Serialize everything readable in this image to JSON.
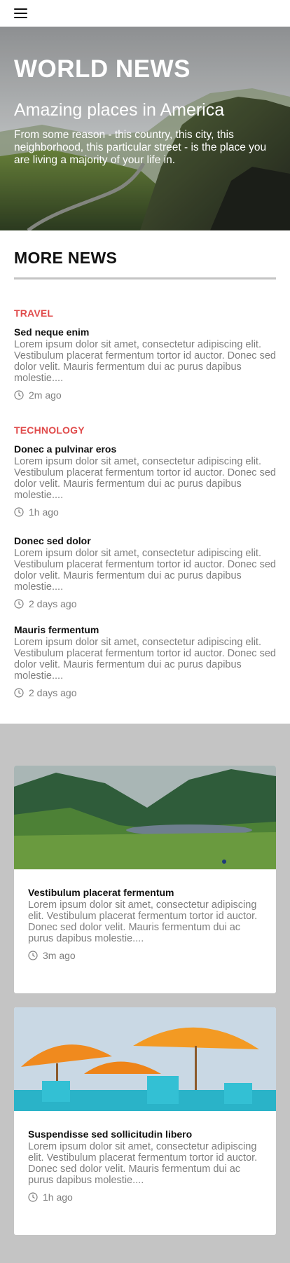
{
  "header": {
    "menu_icon": "hamburger-menu-icon"
  },
  "hero": {
    "title": "WORLD NEWS",
    "subtitle": "Amazing places in America",
    "description": "From some reason - this country, this city, this neighborhood, this particular street - is the place you are living a majority of your life in."
  },
  "more_news": {
    "heading": "MORE NEWS",
    "articles": [
      {
        "category": "TRAVEL",
        "title": "Sed neque enim",
        "body": "Lorem ipsum dolor sit amet, consectetur adipiscing elit. Vestibulum placerat fermentum tortor id auctor. Donec sed dolor velit. Mauris fermentum dui ac purus dapibus molestie....",
        "time": "2m ago"
      },
      {
        "category": "TECHNOLOGY",
        "title": "Donec a pulvinar eros",
        "body": "Lorem ipsum dolor sit amet, consectetur adipiscing elit. Vestibulum placerat fermentum tortor id auctor. Donec sed dolor velit. Mauris fermentum dui ac purus dapibus molestie....",
        "time": "1h ago"
      },
      {
        "title": "Donec sed dolor",
        "body": "Lorem ipsum dolor sit amet, consectetur adipiscing elit. Vestibulum placerat fermentum tortor id auctor. Donec sed dolor velit. Mauris fermentum dui ac purus dapibus molestie....",
        "time": "2 days ago"
      },
      {
        "title": "Mauris fermentum",
        "body": "Lorem ipsum dolor sit amet, consectetur adipiscing elit. Vestibulum placerat fermentum tortor id auctor. Donec sed dolor velit. Mauris fermentum dui ac purus dapibus molestie....",
        "time": "2 days ago"
      }
    ]
  },
  "cards": [
    {
      "image": "green-valley-lake-image",
      "title": "Vestibulum placerat fermentum",
      "body": "Lorem ipsum dolor sit amet, consectetur adipiscing elit. Vestibulum placerat fermentum tortor id auctor. Donec sed dolor velit. Mauris fermentum dui ac purus dapibus molestie....",
      "time": "3m ago"
    },
    {
      "image": "orange-beach-umbrellas-image",
      "title": "Suspendisse sed sollicitudin libero",
      "body": "Lorem ipsum dolor sit amet, consectetur adipiscing elit. Vestibulum placerat fermentum tortor id auctor. Donec sed dolor velit. Mauris fermentum dui ac purus dapibus molestie....",
      "time": "1h ago"
    }
  ],
  "colors": {
    "category": "#e04b4b",
    "muted_text": "#7e7e7e",
    "section_bg": "#c4c4c4"
  }
}
